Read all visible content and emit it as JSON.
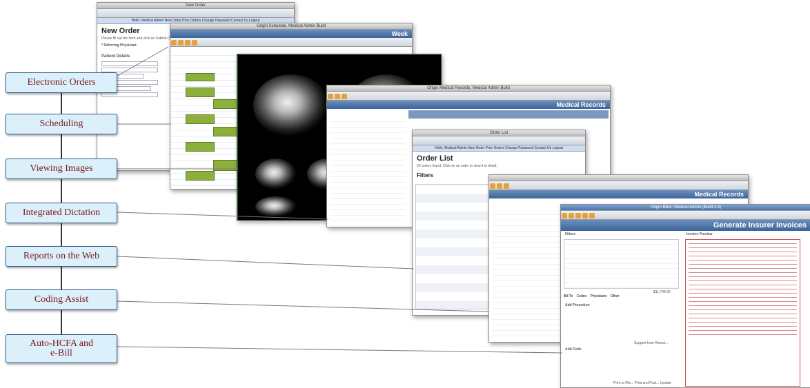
{
  "features": [
    {
      "label": "Electronic Orders"
    },
    {
      "label": "Scheduling"
    },
    {
      "label": "Viewing Images"
    },
    {
      "label": "Integrated Dictation"
    },
    {
      "label": "Reports on the Web"
    },
    {
      "label": "Coding Assist"
    },
    {
      "label": "Auto-HCFA and e-Bill"
    }
  ],
  "screens": {
    "orders": {
      "window_title": "New Order",
      "nav": "Hello, Medical Admin   New Order   Prior Orders   Change Password   Contact Us   Logout",
      "heading": "New Order",
      "subtext": "Please fill out the form and click on Submit Order",
      "referring": "* Referring Physician:",
      "patient_details": "Patient Details"
    },
    "scheduling": {
      "window_title": "Origin Schedule, Medical Admin Build",
      "header": "Week"
    },
    "records1": {
      "window_title": "Origin Medical Records, Medical Admin Build",
      "header": "Medical Records"
    },
    "orderlist": {
      "window_title": "Order List",
      "heading": "Order List",
      "subtext": "20 orders found. Click on an order to view it in detail.",
      "filters": "Filters"
    },
    "records2": {
      "header": "Medical Records"
    },
    "invoices": {
      "window_title": "Origin Biller: Medical Admin (Build 2.8)",
      "header": "Generate Insurer Invoices",
      "filters": "Filters",
      "invoice_preview": "Invoice Preview",
      "tabs": [
        "Bill To",
        "Codes",
        "Physicians",
        "Other"
      ],
      "add_procedure": "Add Procedure",
      "add_code": "Add Code",
      "support": "Support from Report...",
      "footer": "Print to File...  Print and Post...  Update",
      "total": "$11,748.60"
    }
  }
}
